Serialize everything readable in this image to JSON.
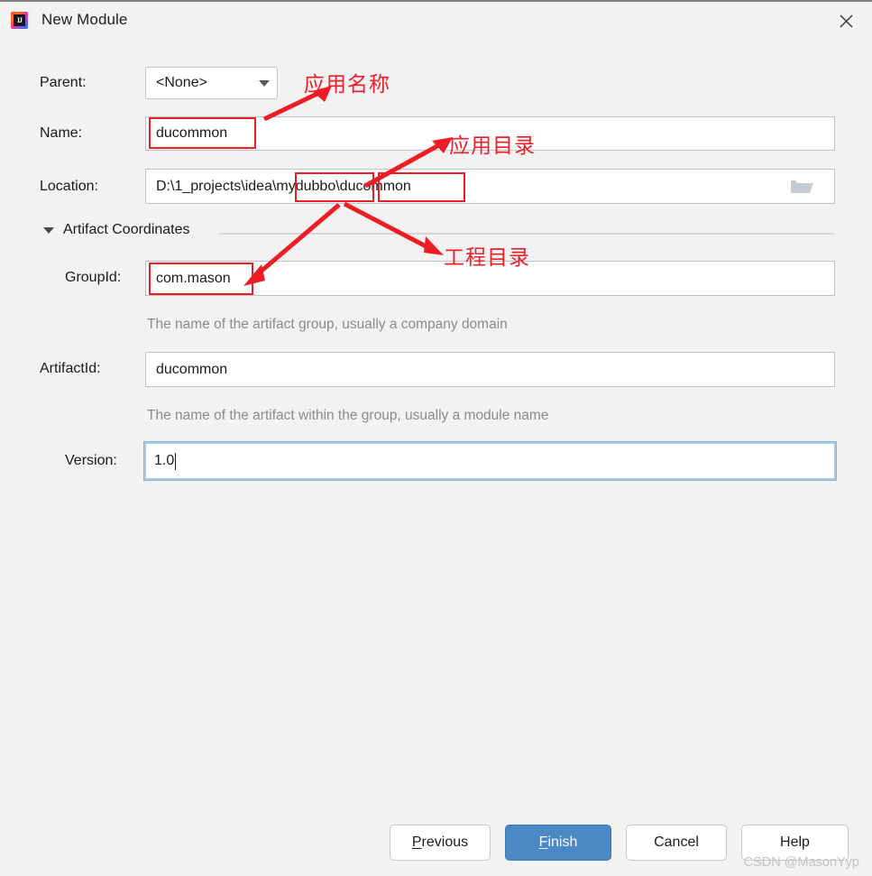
{
  "window": {
    "title": "New Module",
    "app_icon": "intellij-idea-icon",
    "icon_letters": "IJ",
    "close_label": "✕"
  },
  "form": {
    "parent": {
      "label": "Parent:",
      "value": "<None>",
      "dropdown_icon": "chevron-down-icon"
    },
    "name": {
      "label": "Name:",
      "value": "ducommon"
    },
    "location": {
      "label": "Location:",
      "value": "D:\\1_projects\\idea\\mydubbo\\ducommon",
      "browse_icon": "folder-icon"
    },
    "section": {
      "label": "Artifact Coordinates",
      "collapse_icon": "triangle-down-icon"
    },
    "group_id": {
      "label": "GroupId:",
      "value": "com.mason",
      "hint": "The name of the artifact group, usually a company domain"
    },
    "artifact_id": {
      "label": "ArtifactId:",
      "value": "ducommon",
      "hint": "The name of the artifact within the group, usually a module name"
    },
    "version": {
      "label": "Version:",
      "value": "1.0",
      "focused": true
    }
  },
  "annotations": [
    {
      "text": "应用名称",
      "meaning": "application-name"
    },
    {
      "text": "应用目录",
      "meaning": "application-directory"
    },
    {
      "text": "工程目录",
      "meaning": "project-directory"
    }
  ],
  "buttons": {
    "previous": {
      "pre": "P",
      "post": "revious"
    },
    "finish": {
      "pre": "F",
      "post": "inish"
    },
    "cancel": "Cancel",
    "help": "Help"
  },
  "watermark": "CSDN @MasonYyp",
  "colors": {
    "background": "#f2f2f2",
    "primary_button": "#4c87c6",
    "annotation_red": "#ee1c25",
    "focus_blue": "#a9cbe8"
  }
}
